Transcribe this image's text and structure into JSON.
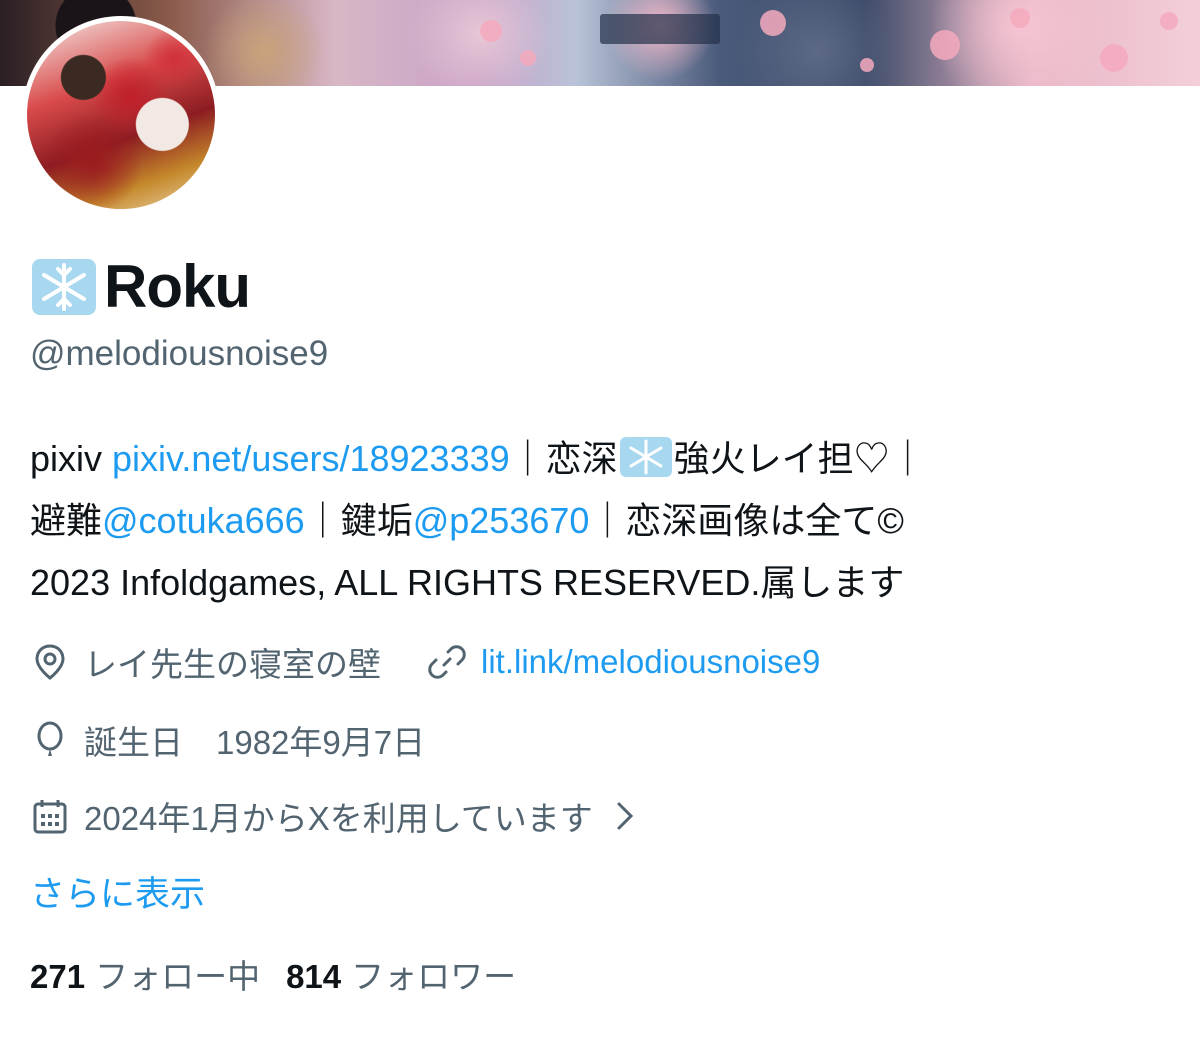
{
  "profile": {
    "name": "Roku",
    "handle": "@melodiousnoise9"
  },
  "bio": {
    "segments": {
      "pixiv_label": "pixiv ",
      "pixiv_link": "pixiv.net/users/18923339",
      "part1": "｜恋深",
      "part2": "強火レイ担♡｜",
      "part3": "避難",
      "evac_link": "@cotuka666",
      "part4": "｜鍵垢",
      "lock_link": "@p253670",
      "part5": "｜恋深画像は全て©",
      "part6": "2023 Infoldgames, ALL RIGHTS RESERVED.属します"
    }
  },
  "meta": {
    "location": "レイ先生の寝室の壁",
    "website": "lit.link/melodiousnoise9",
    "birthday": "誕生日　1982年9月7日",
    "joined": "2024年1月からXを利用しています"
  },
  "show_more": "さらに表示",
  "stats": {
    "following_count": "271",
    "following_label": "フォロー中",
    "followers_count": "814",
    "followers_label": "フォロワー"
  },
  "colors": {
    "link": "#1d9bf0",
    "secondary_text": "#536471",
    "primary_text": "#0f1419"
  },
  "icons": {
    "name_emoji": "snowflake-icon",
    "location": "location-pin-icon",
    "website": "link-icon",
    "birthday": "balloon-icon",
    "joined": "calendar-icon",
    "joined_more": "chevron-right-icon"
  }
}
